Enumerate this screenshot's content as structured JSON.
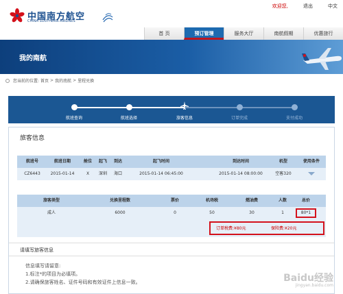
{
  "header": {
    "logo_cn": "中国南方航空",
    "logo_en": "CHINA SOUTHERN AIRLINES",
    "links": [
      "欢迎您,",
      "退出",
      "中文"
    ]
  },
  "nav": {
    "tabs": [
      "首 页",
      "预订管理",
      "服务大厅",
      "南航假期",
      "优惠旅行"
    ],
    "active_tab": "预订管理"
  },
  "banner": {
    "title": "我的南航"
  },
  "breadcrumb": {
    "prefix": "您当前的位置:",
    "items": [
      "首页",
      ">",
      "我的南航",
      ">",
      "里程兑换"
    ]
  },
  "steps": [
    "航班查询",
    "航班选择",
    "旅客信息",
    "订单完成",
    "支付成功"
  ],
  "current_step": "旅客信息",
  "passenger_section": {
    "title": "旅客信息"
  },
  "flight_table": {
    "headers": [
      "航班号",
      "航班日期",
      "舱位",
      "起飞",
      "到达",
      "起飞时间",
      "到达时间",
      "机型",
      "使用条件"
    ],
    "row": [
      "CZ6443",
      "2015-01-14",
      "X",
      "深圳",
      "海口",
      "2015-01-14 06:45:00",
      "2015-01-14 08:00:00",
      "空客320",
      ""
    ]
  },
  "price_table": {
    "headers": [
      "旅客类型",
      "兑换里程数",
      "票价",
      "机场税",
      "燃油费",
      "人数",
      "总价"
    ],
    "row": [
      "成人",
      "6000",
      "0",
      "50",
      "30",
      "1",
      "80*1"
    ]
  },
  "summary": {
    "order_tax": "订单税费:¥80元",
    "insurance": "保险费:¥20元"
  },
  "fill_section": {
    "title": "请填写旅客信息"
  },
  "notes": {
    "heading": "信息填写请留意:",
    "lines": [
      "1.标注*的项目为必填项。",
      "2.请确保旅客姓名、证件号码和有效证件上信息一致。"
    ]
  },
  "watermark": {
    "text": "Baidu经验",
    "sub": "jingyan.baidu.com"
  },
  "colors": {
    "brand_blue": "#1b5793",
    "accent_red": "#d4111b",
    "table_header": "#bcd3ea",
    "table_row": "#e6eff8"
  }
}
